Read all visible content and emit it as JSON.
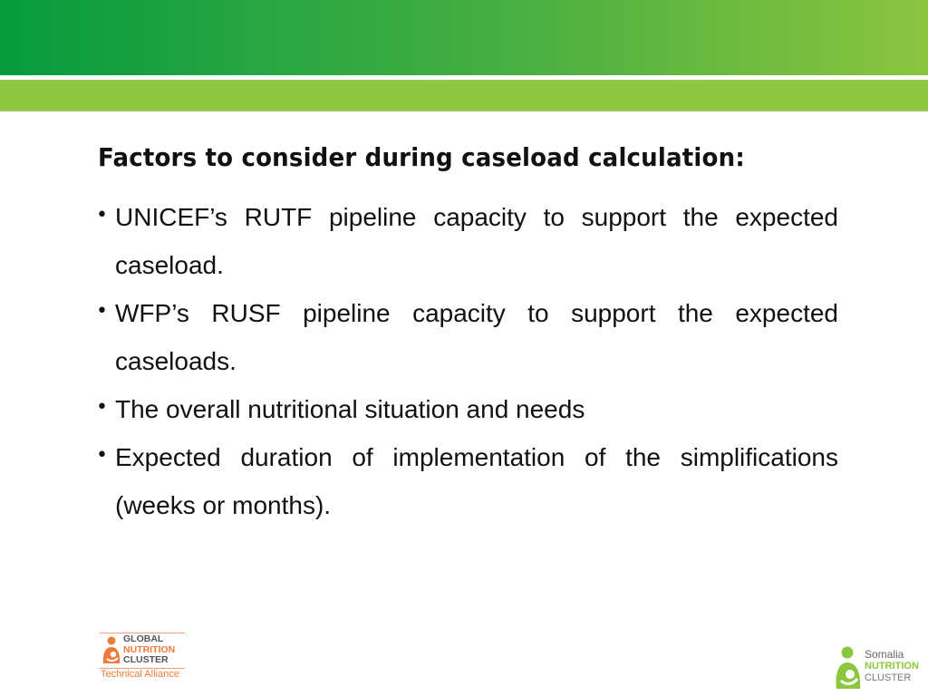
{
  "header": {
    "gradient_start": "#069a3e",
    "gradient_end": "#8bc43f",
    "subband_color": "#8dc63f"
  },
  "slide": {
    "title": "Factors to consider during caseload calculation:",
    "bullet_glyph": "•",
    "bullets": [
      {
        "text": "UNICEF’s RUTF pipeline capacity to support the expected caseload."
      },
      {
        "text": "WFP’s RUSF pipeline capacity to support the expected caseloads."
      },
      {
        "text": "The overall nutritional situation and needs"
      },
      {
        "text": "Expected duration of implementation of the simplifications (weeks or months)."
      }
    ]
  },
  "logos": {
    "left": {
      "line1": "GLOBAL",
      "line2": "NUTRITION",
      "line3": "CLUSTER",
      "tagline": "Technical Alliance",
      "accent": "#f07a3c"
    },
    "right": {
      "line1": "Somalia",
      "line2": "NUTRITION",
      "line3": "CLUSTER",
      "accent": "#8dc63f"
    }
  }
}
